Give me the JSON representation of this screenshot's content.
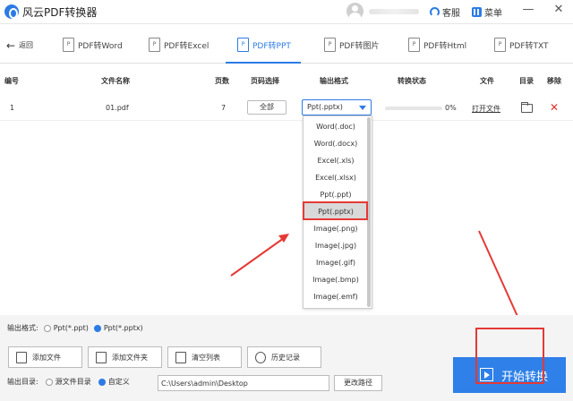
{
  "app": {
    "title": "风云PDF转换器"
  },
  "titlebar": {
    "service": "客服",
    "menu": "菜单",
    "minimize": "—",
    "close": "✕"
  },
  "nav": {
    "back": "返回",
    "tabs": [
      {
        "label": "PDF转Word"
      },
      {
        "label": "PDF转Excel"
      },
      {
        "label": "PDF转PPT"
      },
      {
        "label": "PDF转图片"
      },
      {
        "label": "PDF转Html"
      },
      {
        "label": "PDF转TXT"
      }
    ],
    "active_index": 2
  },
  "table": {
    "headers": [
      "编号",
      "文件名称",
      "页数",
      "页码选择",
      "输出格式",
      "转换状态",
      "文件",
      "目录",
      "移除"
    ],
    "rows": [
      {
        "index": "1",
        "filename": "01.pdf",
        "pages": "7",
        "page_select": "全部",
        "format": "Ppt(.pptx)",
        "progress": 0,
        "progress_text": "0%",
        "open": "打开文件"
      }
    ]
  },
  "dropdown": {
    "options": [
      "Word(.doc)",
      "Word(.docx)",
      "Excel(.xls)",
      "Excel(.xlsx)",
      "Ppt(.ppt)",
      "Ppt(.pptx)",
      "Image(.png)",
      "Image(.jpg)",
      "Image(.gif)",
      "Image(.bmp)",
      "Image(.emf)"
    ],
    "selected_index": 5
  },
  "bottom": {
    "out_format_label": "输出格式:",
    "fmt_ppt": "Ppt(*.ppt)",
    "fmt_pptx": "Ppt(*.pptx)",
    "add_file": "添加文件",
    "add_folder": "添加文件夹",
    "clear_list": "清空列表",
    "history": "历史记录",
    "out_dir_label": "输出目录:",
    "src_dir": "源文件目录",
    "custom": "自定义",
    "path": "C:\\Users\\admin\\Desktop",
    "change_path": "更改路径",
    "start": "开始转换"
  },
  "colors": {
    "accent": "#2c7be5",
    "highlight": "#e53935"
  }
}
